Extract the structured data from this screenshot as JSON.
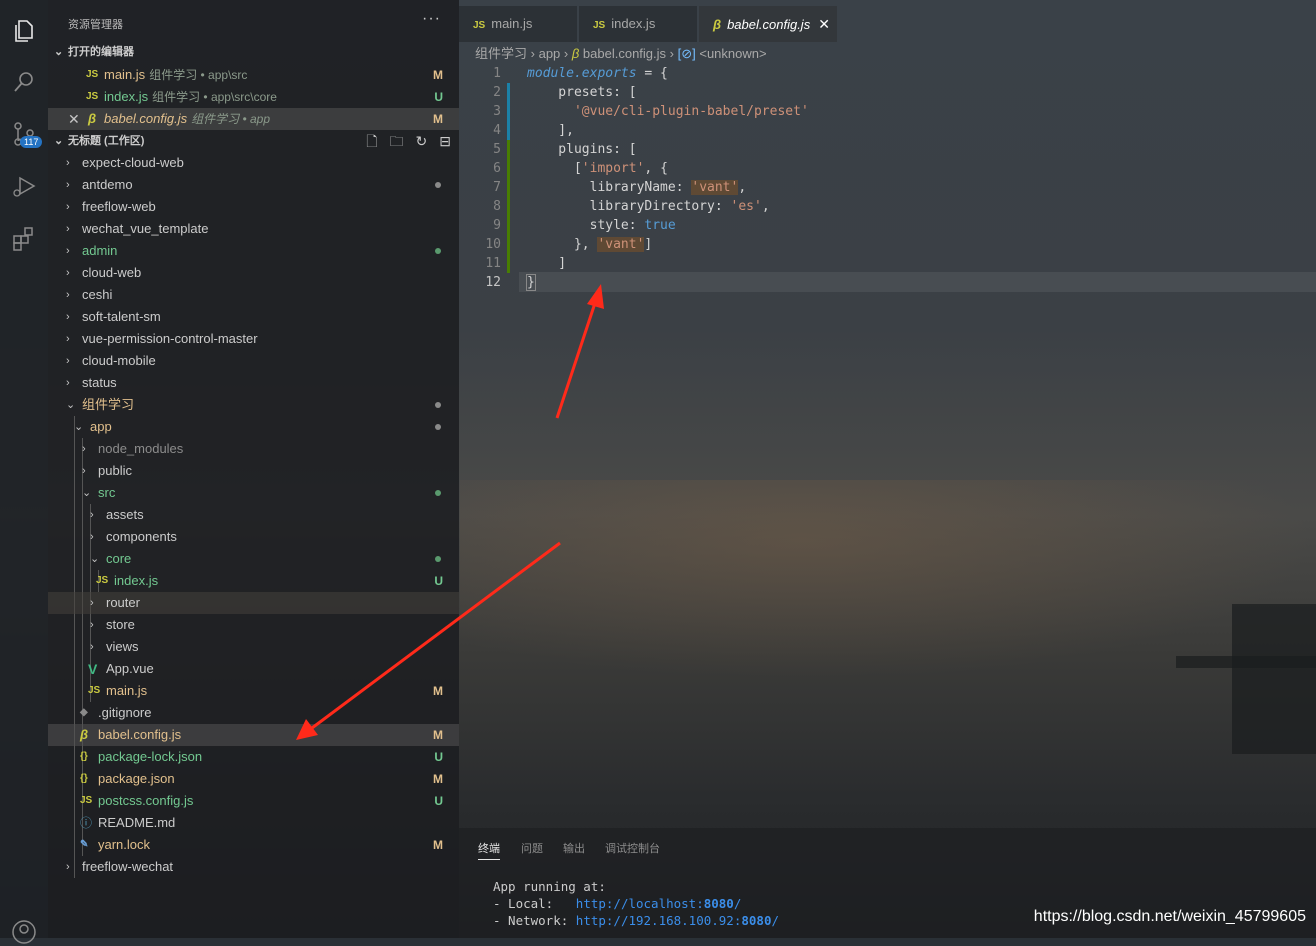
{
  "colors": {
    "accent": "#2473c3",
    "modified": "#e2c08d",
    "untracked": "#73c991",
    "js": "#cbcb41",
    "arrow": "#ff2a1a"
  },
  "activity": {
    "items": [
      {
        "icon": "files-icon"
      },
      {
        "icon": "search-icon"
      },
      {
        "icon": "source-control-icon",
        "badge": "117"
      },
      {
        "icon": "run-debug-icon"
      },
      {
        "icon": "extensions-icon"
      },
      {
        "icon": "account-icon"
      }
    ]
  },
  "sidebar": {
    "title": "资源管理器",
    "more": "···",
    "open_editors": {
      "label": "打开的编辑器",
      "items": [
        {
          "name": "main.js",
          "desc": "组件学习 • app\\src",
          "status": "M"
        },
        {
          "name": "index.js",
          "desc": "组件学习 • app\\src\\core",
          "status": "U"
        },
        {
          "name": "babel.config.js",
          "desc": "组件学习 • app",
          "status": "M"
        }
      ]
    },
    "workspace": {
      "label": "无标题 (工作区)",
      "items": [
        {
          "name": "expect-cloud-web"
        },
        {
          "name": "antdemo"
        },
        {
          "name": "freeflow-web"
        },
        {
          "name": "wechat_vue_template"
        },
        {
          "name": "admin"
        },
        {
          "name": "cloud-web"
        },
        {
          "name": "ceshi"
        },
        {
          "name": "soft-talent-sm"
        },
        {
          "name": "vue-permission-control-master"
        },
        {
          "name": "cloud-mobile"
        },
        {
          "name": "status"
        },
        {
          "name": "组件学习"
        },
        {
          "name": "app"
        },
        {
          "name": "node_modules"
        },
        {
          "name": "public"
        },
        {
          "name": "src"
        },
        {
          "name": "assets"
        },
        {
          "name": "components"
        },
        {
          "name": "core"
        },
        {
          "name": "index.js",
          "status": "U",
          "icon": "JS"
        },
        {
          "name": "router"
        },
        {
          "name": "store"
        },
        {
          "name": "views"
        },
        {
          "name": "App.vue",
          "icon": "V"
        },
        {
          "name": "main.js",
          "status": "M",
          "icon": "JS"
        },
        {
          "name": ".gitignore"
        },
        {
          "name": "babel.config.js",
          "status": "M"
        },
        {
          "name": "package-lock.json",
          "status": "U",
          "icon": "{}"
        },
        {
          "name": "package.json",
          "status": "M",
          "icon": "{}"
        },
        {
          "name": "postcss.config.js",
          "status": "U",
          "icon": "JS"
        },
        {
          "name": "README.md",
          "icon": "ⓘ"
        },
        {
          "name": "yarn.lock",
          "status": "M"
        },
        {
          "name": "freeflow-wechat"
        }
      ]
    }
  },
  "tabs": [
    {
      "label": "main.js",
      "icon": "JS"
    },
    {
      "label": "index.js",
      "icon": "JS"
    },
    {
      "label": "babel.config.js",
      "close": "✕"
    }
  ],
  "breadcrumb": {
    "parts": [
      "组件学习",
      "app",
      "babel.config.js",
      "<unknown>"
    ]
  },
  "code": {
    "line_numbers": [
      "1",
      "2",
      "3",
      "4",
      "5",
      "6",
      "7",
      "8",
      "9",
      "10",
      "11",
      "12"
    ],
    "lines": [
      [
        "module.exports",
        " = {"
      ],
      [
        "    presets: ["
      ],
      [
        "      ",
        "'@vue/cli-plugin-babel/preset'"
      ],
      [
        "    ],"
      ],
      [
        "    plugins: ["
      ],
      [
        "      [",
        "'import'",
        ", {"
      ],
      [
        "        libraryName: ",
        "'vant'",
        ","
      ],
      [
        "        libraryDirectory: ",
        "'es'",
        ","
      ],
      [
        "        style: ",
        "true"
      ],
      [
        "      }, ",
        "'vant'",
        "]"
      ],
      [
        "    ]"
      ],
      [
        "}"
      ]
    ]
  },
  "panel": {
    "tabs": [
      "终端",
      "问题",
      "输出",
      "调试控制台"
    ],
    "terminal": {
      "line1": "App running at:",
      "local_label": "- Local:   ",
      "local_url": "http://localhost:",
      "local_port": "8080",
      "net_label": "- Network: ",
      "net_url": "http://192.168.100.92:",
      "net_port": "8080",
      "slash": "/"
    }
  },
  "watermark": "https://blog.csdn.net/weixin_45799605"
}
